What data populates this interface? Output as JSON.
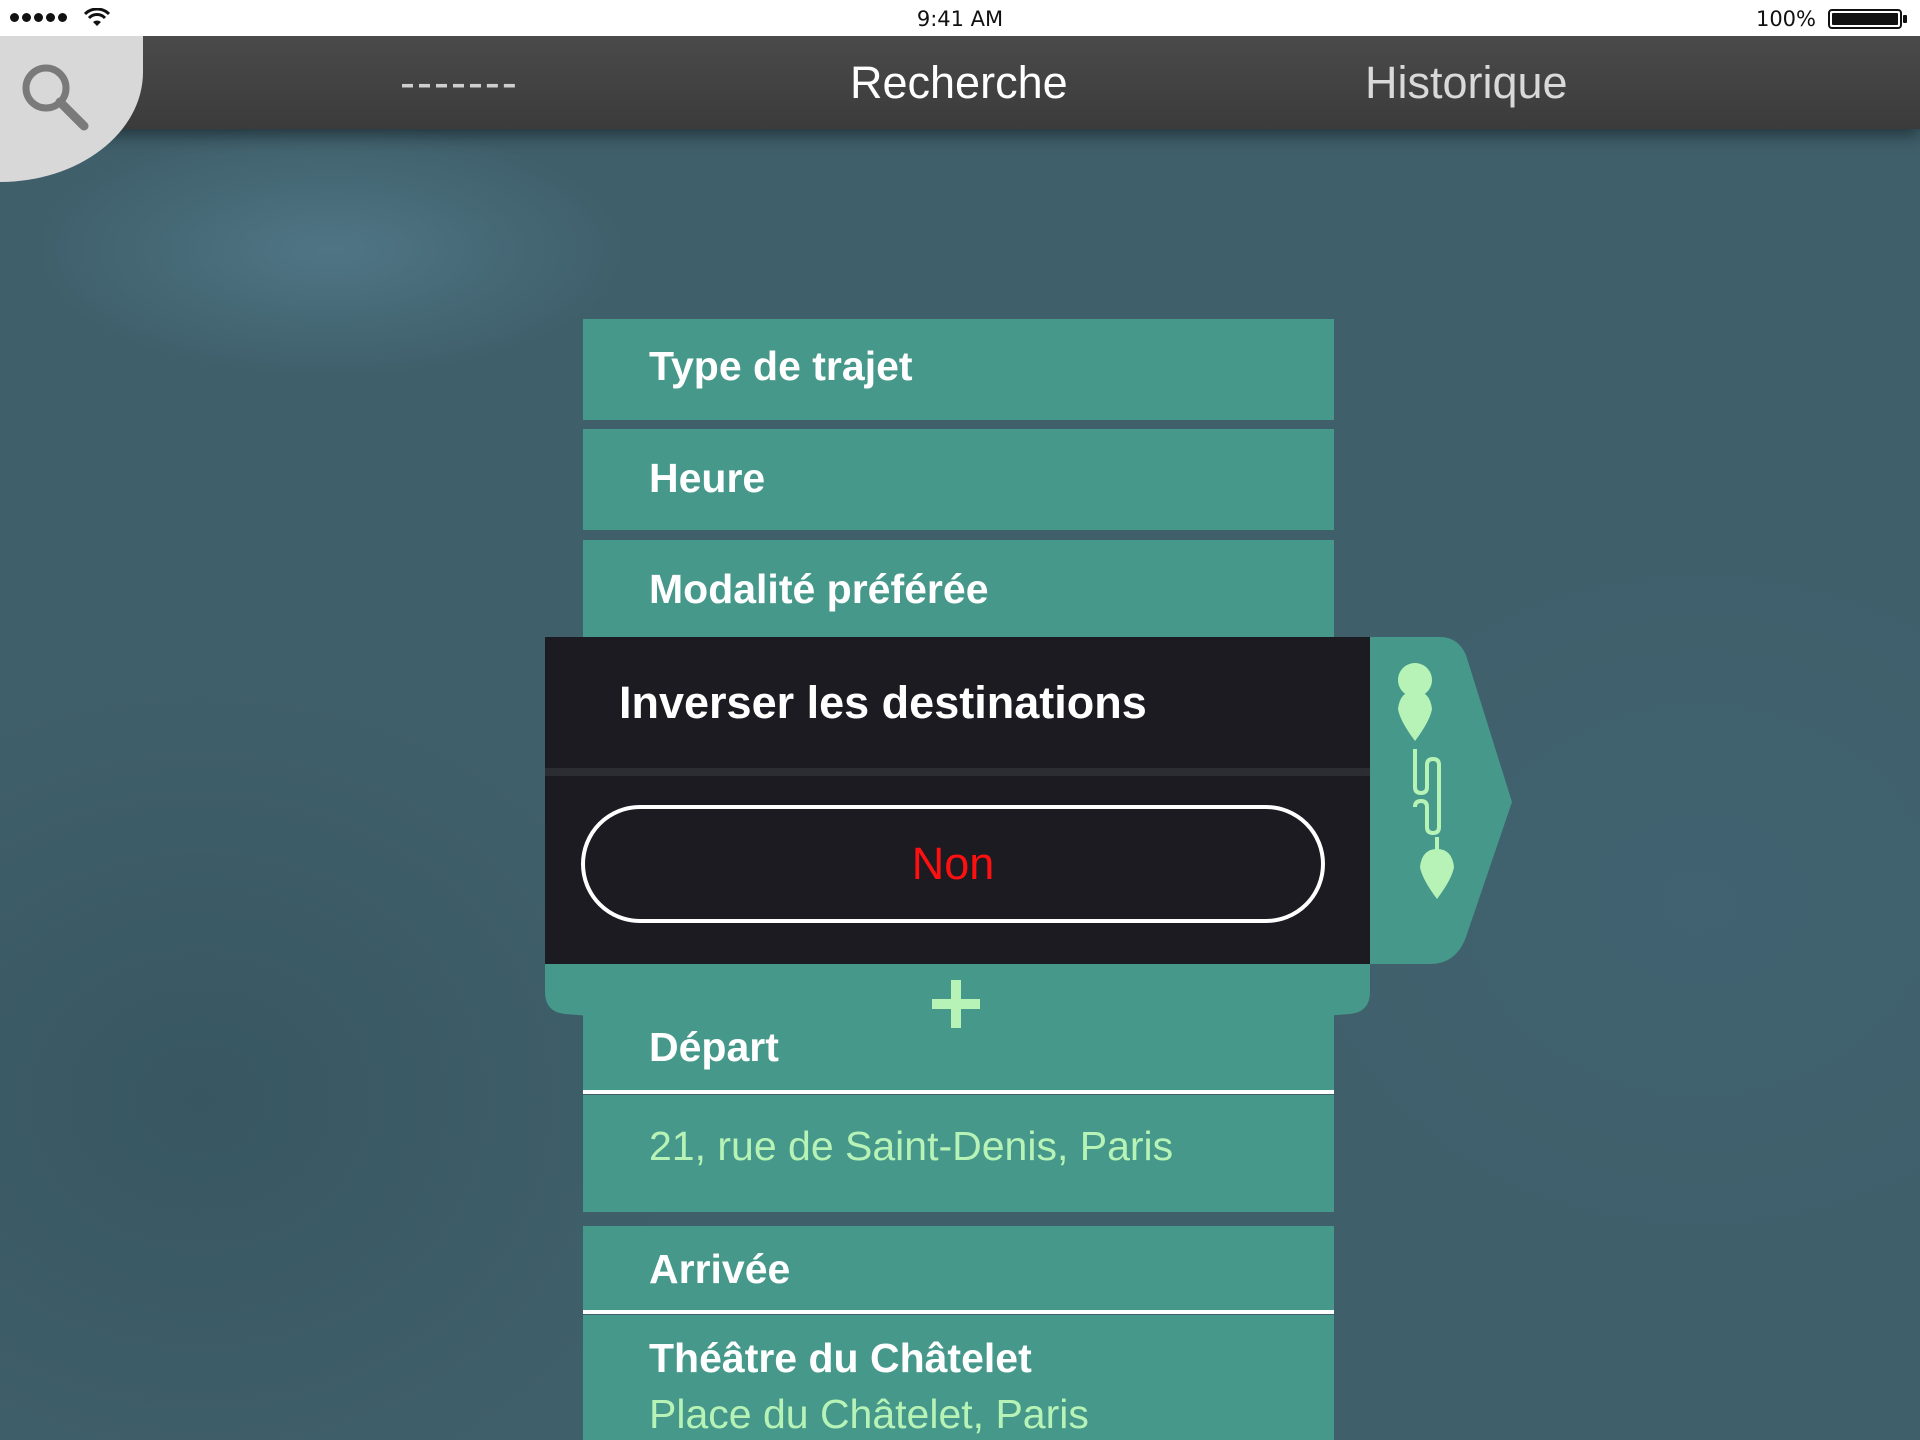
{
  "status_bar": {
    "time": "9:41 AM",
    "battery": "100%"
  },
  "nav": {
    "placeholder_tab": "-------",
    "search_tab": "Recherche",
    "history_tab": "Historique"
  },
  "form": {
    "trip_type_label": "Type de trajet",
    "time_label": "Heure",
    "mode_label": "Modalité préférée",
    "departure_label": "Départ",
    "departure_address": "21, rue de Saint-Denis, Paris",
    "arrival_label": "Arrivée",
    "arrival_name": "Théâtre du Châtelet",
    "arrival_address": "Place du Châtelet, Paris"
  },
  "popup": {
    "title": "Inverser les destinations",
    "option": "Non"
  },
  "colors": {
    "row_green": "#45988a",
    "light_green": "#b7f3b6",
    "popup_dark": "#1c1b22",
    "option_red": "#ff1010"
  }
}
